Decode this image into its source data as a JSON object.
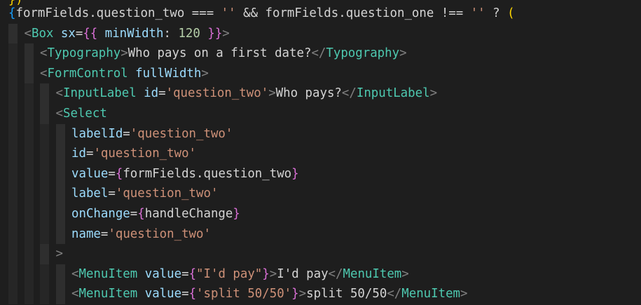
{
  "editor": {
    "top_fragment": "})",
    "lines": [
      {
        "indent": 0,
        "tokens": [
          {
            "t": "{",
            "c": "b3"
          },
          {
            "t": "formFields",
            "c": "var"
          },
          {
            "t": ".",
            "c": "op"
          },
          {
            "t": "question_two",
            "c": "var"
          },
          {
            "t": " === ",
            "c": "op"
          },
          {
            "t": "''",
            "c": "str"
          },
          {
            "t": " && ",
            "c": "op"
          },
          {
            "t": "formFields",
            "c": "var"
          },
          {
            "t": ".",
            "c": "op"
          },
          {
            "t": "question_one",
            "c": "var"
          },
          {
            "t": " !== ",
            "c": "op"
          },
          {
            "t": "''",
            "c": "str"
          },
          {
            "t": " ? ",
            "c": "op"
          },
          {
            "t": "(",
            "c": "b1"
          }
        ]
      },
      {
        "indent": 1,
        "tokens": [
          {
            "t": "<",
            "c": "bracket"
          },
          {
            "t": "Box",
            "c": "comp"
          },
          {
            "t": " sx",
            "c": "attr"
          },
          {
            "t": "=",
            "c": "op"
          },
          {
            "t": "{{",
            "c": "b2"
          },
          {
            "t": " minWidth",
            "c": "attr"
          },
          {
            "t": ": ",
            "c": "op"
          },
          {
            "t": "120",
            "c": "num"
          },
          {
            "t": " }}",
            "c": "b2"
          },
          {
            "t": ">",
            "c": "bracket"
          }
        ]
      },
      {
        "indent": 2,
        "tokens": [
          {
            "t": "<",
            "c": "bracket"
          },
          {
            "t": "Typography",
            "c": "comp"
          },
          {
            "t": ">",
            "c": "bracket"
          },
          {
            "t": "Who pays on a first date?",
            "c": "plain"
          },
          {
            "t": "</",
            "c": "bracket"
          },
          {
            "t": "Typography",
            "c": "comp"
          },
          {
            "t": ">",
            "c": "bracket"
          }
        ]
      },
      {
        "indent": 2,
        "tokens": [
          {
            "t": "<",
            "c": "bracket"
          },
          {
            "t": "FormControl",
            "c": "comp"
          },
          {
            "t": " fullWidth",
            "c": "attr"
          },
          {
            "t": ">",
            "c": "bracket"
          }
        ]
      },
      {
        "indent": 3,
        "tokens": [
          {
            "t": "<",
            "c": "bracket"
          },
          {
            "t": "InputLabel",
            "c": "comp"
          },
          {
            "t": " id",
            "c": "attr"
          },
          {
            "t": "=",
            "c": "op"
          },
          {
            "t": "'question_two'",
            "c": "str"
          },
          {
            "t": ">",
            "c": "bracket"
          },
          {
            "t": "Who pays?",
            "c": "plain"
          },
          {
            "t": "</",
            "c": "bracket"
          },
          {
            "t": "InputLabel",
            "c": "comp"
          },
          {
            "t": ">",
            "c": "bracket"
          }
        ]
      },
      {
        "indent": 3,
        "tokens": [
          {
            "t": "<",
            "c": "bracket"
          },
          {
            "t": "Select",
            "c": "comp"
          }
        ]
      },
      {
        "indent": 4,
        "tokens": [
          {
            "t": "labelId",
            "c": "attr"
          },
          {
            "t": "=",
            "c": "op"
          },
          {
            "t": "'question_two'",
            "c": "str"
          }
        ]
      },
      {
        "indent": 4,
        "tokens": [
          {
            "t": "id",
            "c": "attr"
          },
          {
            "t": "=",
            "c": "op"
          },
          {
            "t": "'question_two'",
            "c": "str"
          }
        ]
      },
      {
        "indent": 4,
        "tokens": [
          {
            "t": "value",
            "c": "attr"
          },
          {
            "t": "=",
            "c": "op"
          },
          {
            "t": "{",
            "c": "b2"
          },
          {
            "t": "formFields",
            "c": "var"
          },
          {
            "t": ".",
            "c": "op"
          },
          {
            "t": "question_two",
            "c": "var"
          },
          {
            "t": "}",
            "c": "b2"
          }
        ]
      },
      {
        "indent": 4,
        "tokens": [
          {
            "t": "label",
            "c": "attr"
          },
          {
            "t": "=",
            "c": "op"
          },
          {
            "t": "'question_two'",
            "c": "str"
          }
        ]
      },
      {
        "indent": 4,
        "tokens": [
          {
            "t": "onChange",
            "c": "attr"
          },
          {
            "t": "=",
            "c": "op"
          },
          {
            "t": "{",
            "c": "b2"
          },
          {
            "t": "handleChange",
            "c": "fn"
          },
          {
            "t": "}",
            "c": "b2"
          }
        ]
      },
      {
        "indent": 4,
        "tokens": [
          {
            "t": "name",
            "c": "attr"
          },
          {
            "t": "=",
            "c": "op"
          },
          {
            "t": "'question_two'",
            "c": "str"
          }
        ]
      },
      {
        "indent": 3,
        "tokens": [
          {
            "t": ">",
            "c": "bracket"
          }
        ]
      },
      {
        "indent": 4,
        "tokens": [
          {
            "t": "<",
            "c": "bracket"
          },
          {
            "t": "MenuItem",
            "c": "comp"
          },
          {
            "t": " value",
            "c": "attr"
          },
          {
            "t": "=",
            "c": "op"
          },
          {
            "t": "{",
            "c": "b2"
          },
          {
            "t": "\"I'd pay\"",
            "c": "str"
          },
          {
            "t": "}",
            "c": "b2"
          },
          {
            "t": ">",
            "c": "bracket"
          },
          {
            "t": "I'd pay",
            "c": "plain"
          },
          {
            "t": "</",
            "c": "bracket"
          },
          {
            "t": "MenuItem",
            "c": "comp"
          },
          {
            "t": ">",
            "c": "bracket"
          }
        ]
      },
      {
        "indent": 4,
        "tokens": [
          {
            "t": "<",
            "c": "bracket"
          },
          {
            "t": "MenuItem",
            "c": "comp"
          },
          {
            "t": " value",
            "c": "attr"
          },
          {
            "t": "=",
            "c": "op"
          },
          {
            "t": "{",
            "c": "b2"
          },
          {
            "t": "'split 50/50'",
            "c": "str"
          },
          {
            "t": "}",
            "c": "b2"
          },
          {
            "t": ">",
            "c": "bracket"
          },
          {
            "t": "split 50/50",
            "c": "plain"
          },
          {
            "t": "</",
            "c": "bracket"
          },
          {
            "t": "MenuItem",
            "c": "comp"
          },
          {
            "t": ">",
            "c": "bracket"
          }
        ]
      }
    ]
  },
  "colors": {
    "background": "#1e1e1e",
    "comp": "#4ec9b0",
    "attr": "#9cdcfe",
    "str": "#ce9178",
    "plain": "#d4d4d4",
    "bracket": "#808080",
    "b1": "#ffd700",
    "b2": "#da70d6",
    "b3": "#179fff",
    "num": "#b5cea8"
  }
}
